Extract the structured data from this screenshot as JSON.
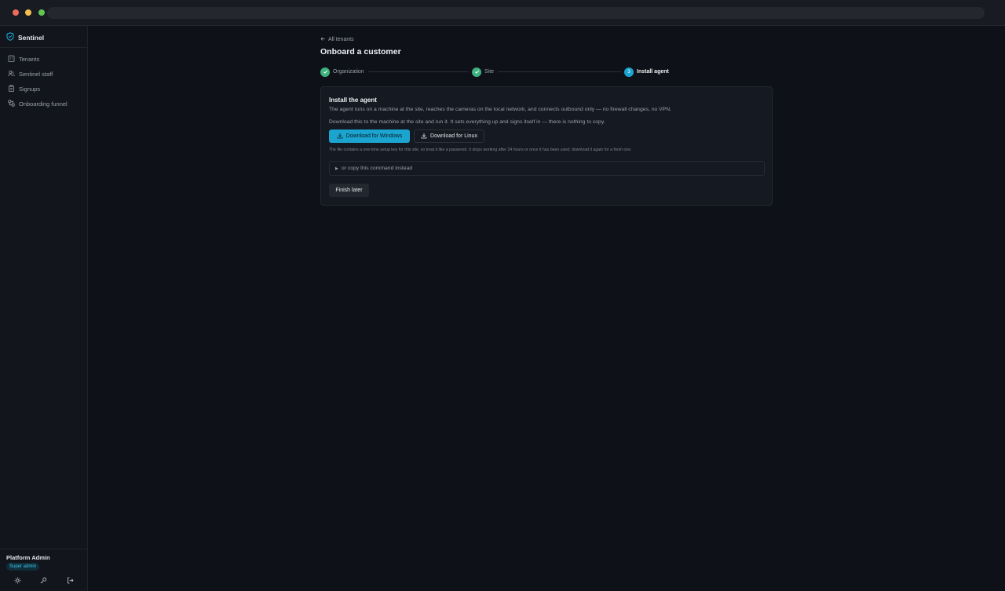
{
  "sidebar": {
    "brand": "Sentinel",
    "items": [
      {
        "label": "Tenants",
        "icon": "building-icon"
      },
      {
        "label": "Sentinel staff",
        "icon": "users-icon"
      },
      {
        "label": "Signups",
        "icon": "clipboard-icon"
      },
      {
        "label": "Onboarding funnel",
        "icon": "workflow-icon"
      }
    ],
    "user": {
      "name": "Platform Admin",
      "role": "Super admin"
    }
  },
  "main": {
    "back_link": "All tenants",
    "title": "Onboard a customer",
    "steps": [
      {
        "label": "Organization",
        "state": "done"
      },
      {
        "label": "Site",
        "state": "done"
      },
      {
        "label": "Install agent",
        "state": "active",
        "number": "3"
      }
    ],
    "card": {
      "title": "Install the agent",
      "description": "The agent runs on a machine at the site, reaches the cameras on the local network, and connects outbound only — no firewall changes, no VPN.",
      "instruction": "Download this to the machine at the site and run it. It sets everything up and signs itself in — there is nothing to copy.",
      "download_windows": "Download for Windows",
      "download_linux": "Download for Linux",
      "note": "The file contains a one-time setup key for this site, so treat it like a password. It stops working after 24 hours or once it has been used; download it again for a fresh one.",
      "copy_command": "or copy this command instead",
      "finish_later": "Finish later"
    }
  },
  "colors": {
    "accent": "#1ba4cf",
    "success": "#3fb27f",
    "background": "#0e1117"
  }
}
